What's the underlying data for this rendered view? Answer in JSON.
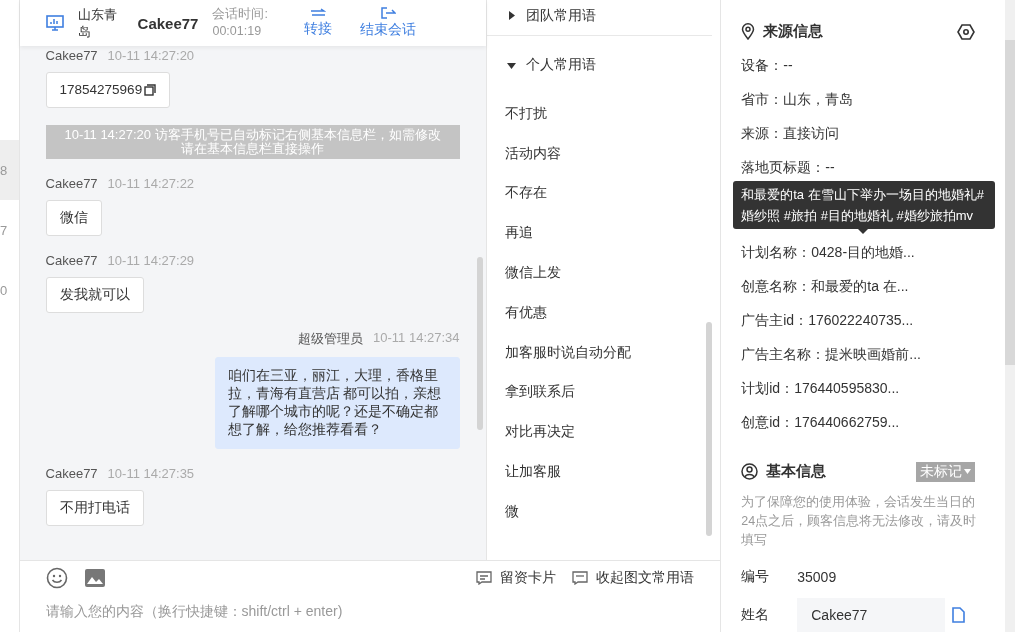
{
  "left_strip": {
    "items": [
      {
        "text": "8",
        "selected": true
      },
      {
        "text": "7",
        "selected": false
      },
      {
        "text": "0",
        "selected": false
      }
    ]
  },
  "header": {
    "location": "山东青岛",
    "visitor": "Cakee77",
    "duration_label": "会话时间:",
    "duration": "00:01:19",
    "actions": [
      {
        "kind": "transfer",
        "label": "转接"
      },
      {
        "kind": "end",
        "label": "结束会话"
      }
    ]
  },
  "messages": [
    {
      "kind": "visitor",
      "sender": "Cakee77",
      "time": "10-11 14:27:20",
      "text": "17854275969",
      "copyable": true
    },
    {
      "kind": "system",
      "text": "10-11 14:27:20 访客手机号已自动标记右侧基本信息栏，如需修改请在基本信息栏直接操作"
    },
    {
      "kind": "visitor",
      "sender": "Cakee77",
      "time": "10-11 14:27:22",
      "text": "微信",
      "copyable": false
    },
    {
      "kind": "visitor",
      "sender": "Cakee77",
      "time": "10-11 14:27:29",
      "text": "发我就可以",
      "copyable": false
    },
    {
      "kind": "agent",
      "sender": "超级管理员",
      "time": "10-11 14:27:34",
      "text": "咱们在三亚，丽江，大理，香格里拉，青海有直营店 都可以拍，亲想了解哪个城市的呢？还是不确定都想了解，给您推荐看看？"
    },
    {
      "kind": "visitor",
      "sender": "Cakee77",
      "time": "10-11 14:27:35",
      "text": "不用打电话",
      "copyable": false
    }
  ],
  "composer": {
    "placeholder": "请输入您的内容（换行快捷键：shift/ctrl + enter)",
    "tools": [
      {
        "kind": "card",
        "label": "留资卡片"
      },
      {
        "kind": "collapse",
        "label": "收起图文常用语"
      }
    ]
  },
  "phrases": {
    "groups": [
      {
        "title": "团队常用语",
        "expanded": false
      },
      {
        "title": "个人常用语",
        "expanded": true,
        "items": [
          "不打扰",
          "活动内容",
          "不存在",
          "再追",
          "微信上发",
          "有优惠",
          "加客服时说自动分配",
          "拿到联系后",
          "对比再决定",
          "让加客服",
          "微"
        ]
      }
    ]
  },
  "source_info": {
    "title": "来源信息",
    "rows": [
      {
        "kind": "row",
        "text": "设备：--"
      },
      {
        "kind": "row",
        "text": "省市：山东，青岛"
      },
      {
        "kind": "row",
        "text": "来源：直接访问"
      },
      {
        "kind": "row",
        "text": "落地页标题：--"
      },
      {
        "kind": "tooltip",
        "text": "和最爱的ta 在雪山下举办一场目的地婚礼#婚纱照 #旅拍 #目的地婚礼 #婚纱旅拍mv"
      },
      {
        "kind": "row",
        "text": "计划名称：0428-目的地婚..."
      },
      {
        "kind": "row",
        "text": "创意名称：和最爱的ta 在..."
      },
      {
        "kind": "row",
        "text": "广告主id：176022240735..."
      },
      {
        "kind": "row",
        "text": "广告主名称：提米映画婚前..."
      },
      {
        "kind": "row",
        "text": "计划id：176440595830..."
      },
      {
        "kind": "row",
        "text": "创意id：176440662759..."
      }
    ]
  },
  "basic_info": {
    "title": "基本信息",
    "tag": "未标记",
    "note": "为了保障您的使用体验，会话发生当日的24点之后，顾客信息将无法修改，请及时填写",
    "fields": [
      {
        "label": "编号",
        "value": "35009",
        "kind": "text"
      },
      {
        "label": "姓名",
        "value": "Cakee77",
        "kind": "input"
      }
    ]
  }
}
